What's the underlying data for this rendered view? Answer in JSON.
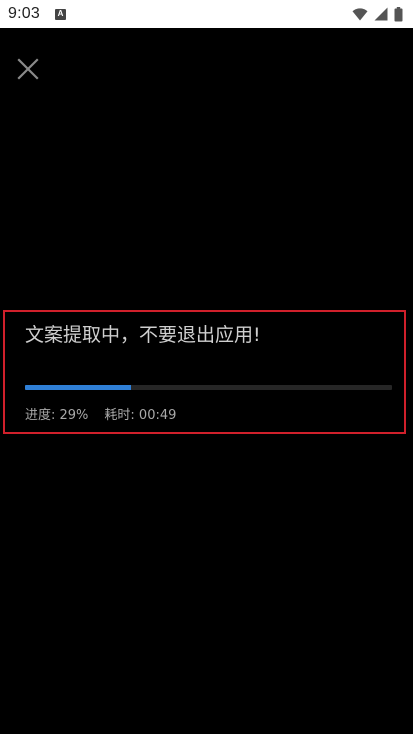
{
  "status_bar": {
    "time": "9:03",
    "notification_icon_letter": "A",
    "icons": [
      "wifi-icon",
      "signal-icon",
      "battery-icon"
    ]
  },
  "close_icon": "close-icon",
  "extraction": {
    "title": "文案提取中，不要退出应用!",
    "progress_percent": 29,
    "progress_text": "进度: 29%",
    "elapsed_text": "耗时: 00:49",
    "accent_color": "#2f7fd6",
    "highlight_color": "#d0202b"
  }
}
